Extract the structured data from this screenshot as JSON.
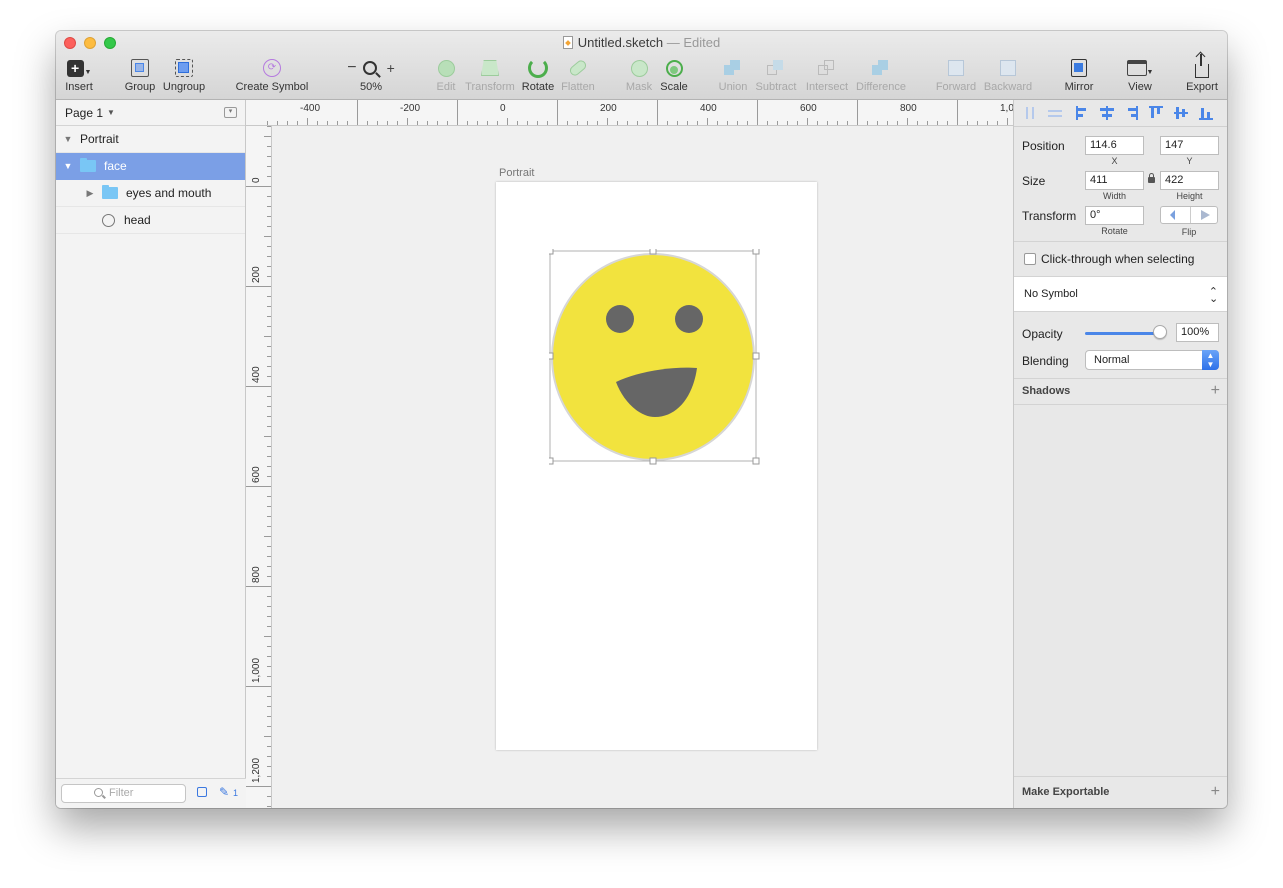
{
  "window": {
    "title": "Untitled.sketch",
    "title_sep": "—",
    "title_status": "Edited"
  },
  "toolbar": {
    "insert": "Insert",
    "group": "Group",
    "ungroup": "Ungroup",
    "create_symbol": "Create Symbol",
    "zoom_minus": "−",
    "zoom_plus": "+",
    "zoom_level": "50%",
    "edit": "Edit",
    "transform": "Transform",
    "rotate": "Rotate",
    "flatten": "Flatten",
    "mask": "Mask",
    "scale": "Scale",
    "union": "Union",
    "subtract": "Subtract",
    "intersect": "Intersect",
    "difference": "Difference",
    "forward": "Forward",
    "backward": "Backward",
    "mirror": "Mirror",
    "view": "View",
    "export": "Export"
  },
  "layers_panel": {
    "page_selector": "Page 1",
    "items": [
      {
        "label": "Portrait",
        "type": "artboard"
      },
      {
        "label": "face",
        "type": "group",
        "selected": true
      },
      {
        "label": "eyes and mouth",
        "type": "group"
      },
      {
        "label": "head",
        "type": "oval"
      }
    ],
    "filter_placeholder": "Filter",
    "badge_count": "1"
  },
  "rulers": {
    "horizontal": [
      "-400",
      "-200",
      "0",
      "200",
      "400",
      "600",
      "800",
      "1,0"
    ],
    "vertical": [
      "0",
      "200",
      "400",
      "600",
      "800",
      "1,000",
      "1,200"
    ]
  },
  "canvas": {
    "artboard_name": "Portrait",
    "colors": {
      "face_fill": "#f2e33e",
      "face_stroke": "#d6d6d6",
      "features": "#666666",
      "selection": "#b0b0b0"
    }
  },
  "inspector": {
    "position_label": "Position",
    "x_value": "114.6",
    "y_value": "147",
    "x_label": "X",
    "y_label": "Y",
    "size_label": "Size",
    "width_value": "411",
    "height_value": "422",
    "width_label": "Width",
    "height_label": "Height",
    "transform_label": "Transform",
    "rotate_value": "0°",
    "rotate_label": "Rotate",
    "flip_label": "Flip",
    "click_through_label": "Click-through when selecting",
    "symbol_value": "No Symbol",
    "opacity_label": "Opacity",
    "opacity_value": "100%",
    "opacity_level": 1.0,
    "blending_label": "Blending",
    "blending_value": "Normal",
    "shadows_label": "Shadows",
    "make_exportable_label": "Make Exportable"
  }
}
